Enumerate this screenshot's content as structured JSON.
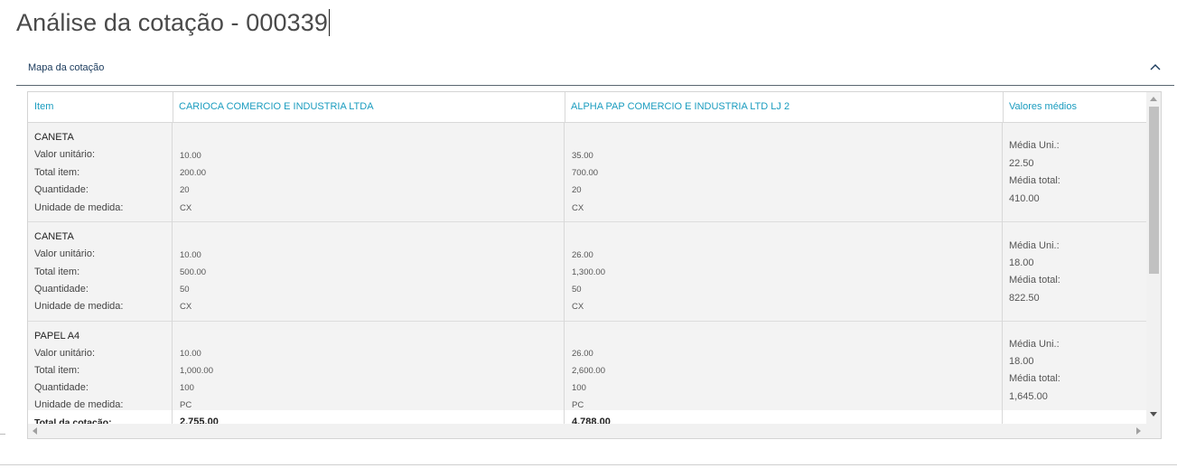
{
  "page": {
    "title": "Análise da cotação - 000339"
  },
  "section": {
    "title": "Mapa da cotação"
  },
  "table": {
    "headers": {
      "item": "Item",
      "supplier1": "CARIOCA COMERCIO E INDUSTRIA LTDA",
      "supplier2": "ALPHA PAP COMERCIO E INDUSTRIA LTD LJ 2",
      "averages": "Valores médios"
    },
    "labels": {
      "unit_value": "Valor unitário:",
      "total_item": "Total item:",
      "quantity": "Quantidade:",
      "unit": "Unidade de medida:",
      "avg_unit": "Média Uni.:",
      "avg_total": "Média total:"
    },
    "rows": [
      {
        "name": "CANETA",
        "s1": {
          "unit_value": "10.00",
          "total_item": "200.00",
          "quantity": "20",
          "unit": "CX"
        },
        "s2": {
          "unit_value": "35.00",
          "total_item": "700.00",
          "quantity": "20",
          "unit": "CX"
        },
        "avg_unit": "22.50",
        "avg_total": "410.00"
      },
      {
        "name": "CANETA",
        "s1": {
          "unit_value": "10.00",
          "total_item": "500.00",
          "quantity": "50",
          "unit": "CX"
        },
        "s2": {
          "unit_value": "26.00",
          "total_item": "1,300.00",
          "quantity": "50",
          "unit": "CX"
        },
        "avg_unit": "18.00",
        "avg_total": "822.50"
      },
      {
        "name": "PAPEL A4",
        "s1": {
          "unit_value": "10.00",
          "total_item": "1,000.00",
          "quantity": "100",
          "unit": "PC"
        },
        "s2": {
          "unit_value": "26.00",
          "total_item": "2,600.00",
          "quantity": "100",
          "unit": "PC"
        },
        "avg_unit": "18.00",
        "avg_total": "1,645.00"
      }
    ],
    "totals": {
      "label": "Total da cotação:",
      "s1": "2,755.00",
      "s2": "4,788.00"
    }
  },
  "colors": {
    "header_link": "#1a9cbf",
    "section_title": "#1a3a5c",
    "row_bg": "#f3f3f3"
  }
}
